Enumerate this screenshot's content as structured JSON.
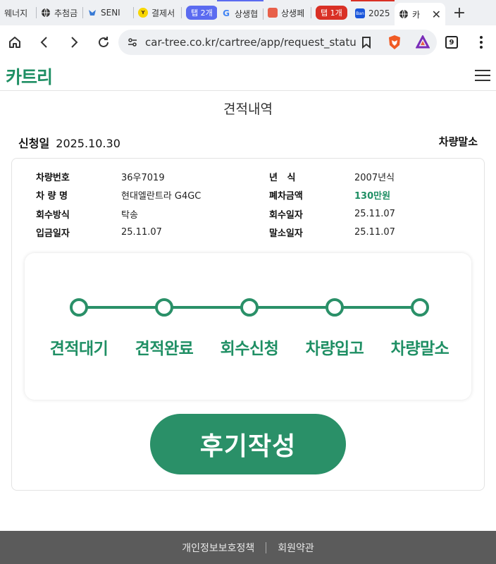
{
  "browser": {
    "tabs": [
      {
        "title": "웨너지",
        "favicon": "doc-icon",
        "color": "#f2a36b"
      },
      {
        "title": "추첨금",
        "favicon": "globe-icon",
        "color": "#333333"
      },
      {
        "title": "SENI",
        "favicon": "bird-icon",
        "color": "#3a7bd5"
      },
      {
        "title": "결제서",
        "favicon": "kakao-icon",
        "color": "#f7d600"
      },
      {
        "group": "탭 2개",
        "group_color": "#5b6bf0"
      },
      {
        "title": "상생협",
        "favicon": "google-icon",
        "color": "#4285f4"
      },
      {
        "title": "상생페",
        "favicon": "app-icon",
        "color": "#e8604a"
      },
      {
        "group": "탭 1개",
        "group_color": "#d93025"
      },
      {
        "title": "2025",
        "favicon": "app-icon",
        "color": "#1a56db"
      },
      {
        "title": "카",
        "favicon": "globe-icon",
        "color": "#333333",
        "active": true
      }
    ],
    "new_tab": "+",
    "url": "car-tree.co.kr/cartree/app/request_status.",
    "tab_count": "9"
  },
  "site": {
    "logo": "카트리",
    "brand_color": "#1f8f64"
  },
  "page": {
    "title": "견적내역",
    "date_label": "신청일",
    "date_value": "2025.10.30",
    "status": "차량말소"
  },
  "info": {
    "left": [
      {
        "label": "차량번호",
        "value": "36우7019"
      },
      {
        "label": "차 량 명",
        "value": "현대엘란트라 G4GC"
      },
      {
        "label": "회수방식",
        "value": "탁송"
      },
      {
        "label": "입금일자",
        "value": "25.11.07"
      }
    ],
    "right": [
      {
        "label": "년   식",
        "value": "2007년식"
      },
      {
        "label": "폐차금액",
        "value": "130만원",
        "accent": true
      },
      {
        "label": "회수일자",
        "value": "25.11.07"
      },
      {
        "label": "말소일자",
        "value": "25.11.07"
      }
    ]
  },
  "progress": {
    "steps": [
      "견적대기",
      "견적완료",
      "회수신청",
      "차량입고",
      "차량말소"
    ],
    "completed": 5,
    "color": "#2a9068"
  },
  "review_button": "후기작성",
  "footer": {
    "privacy": "개인정보보호정책",
    "terms": "회원약관"
  }
}
